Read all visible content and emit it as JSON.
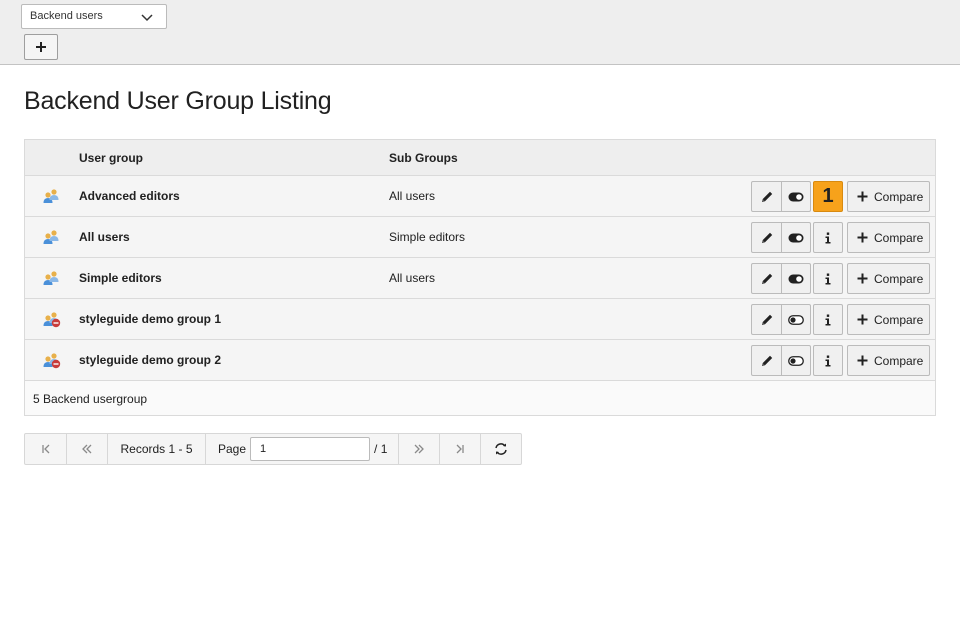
{
  "docheader": {
    "module_select": "Backend users",
    "add_button_icon": "plus-icon"
  },
  "page_title": "Backend User Group Listing",
  "table": {
    "headers": {
      "group": "User group",
      "subgroups": "Sub Groups"
    },
    "rows": [
      {
        "name": "Advanced editors",
        "subgroups": "All users",
        "enabled": true,
        "info_badge": "1"
      },
      {
        "name": "All users",
        "subgroups": "Simple editors",
        "enabled": true,
        "info_badge": ""
      },
      {
        "name": "Simple editors",
        "subgroups": "All users",
        "enabled": true,
        "info_badge": ""
      },
      {
        "name": "styleguide demo group 1",
        "subgroups": "",
        "enabled": false,
        "info_badge": ""
      },
      {
        "name": "styleguide demo group 2",
        "subgroups": "",
        "enabled": false,
        "info_badge": ""
      }
    ],
    "compare_label": "Compare",
    "footer": "5 Backend usergroup"
  },
  "pagination": {
    "records": "Records 1 - 5",
    "page_label": "Page",
    "page_value": "1",
    "page_total": "/ 1"
  },
  "colors": {
    "badge": "#f7a21b",
    "header_bg": "#eeeeee"
  }
}
